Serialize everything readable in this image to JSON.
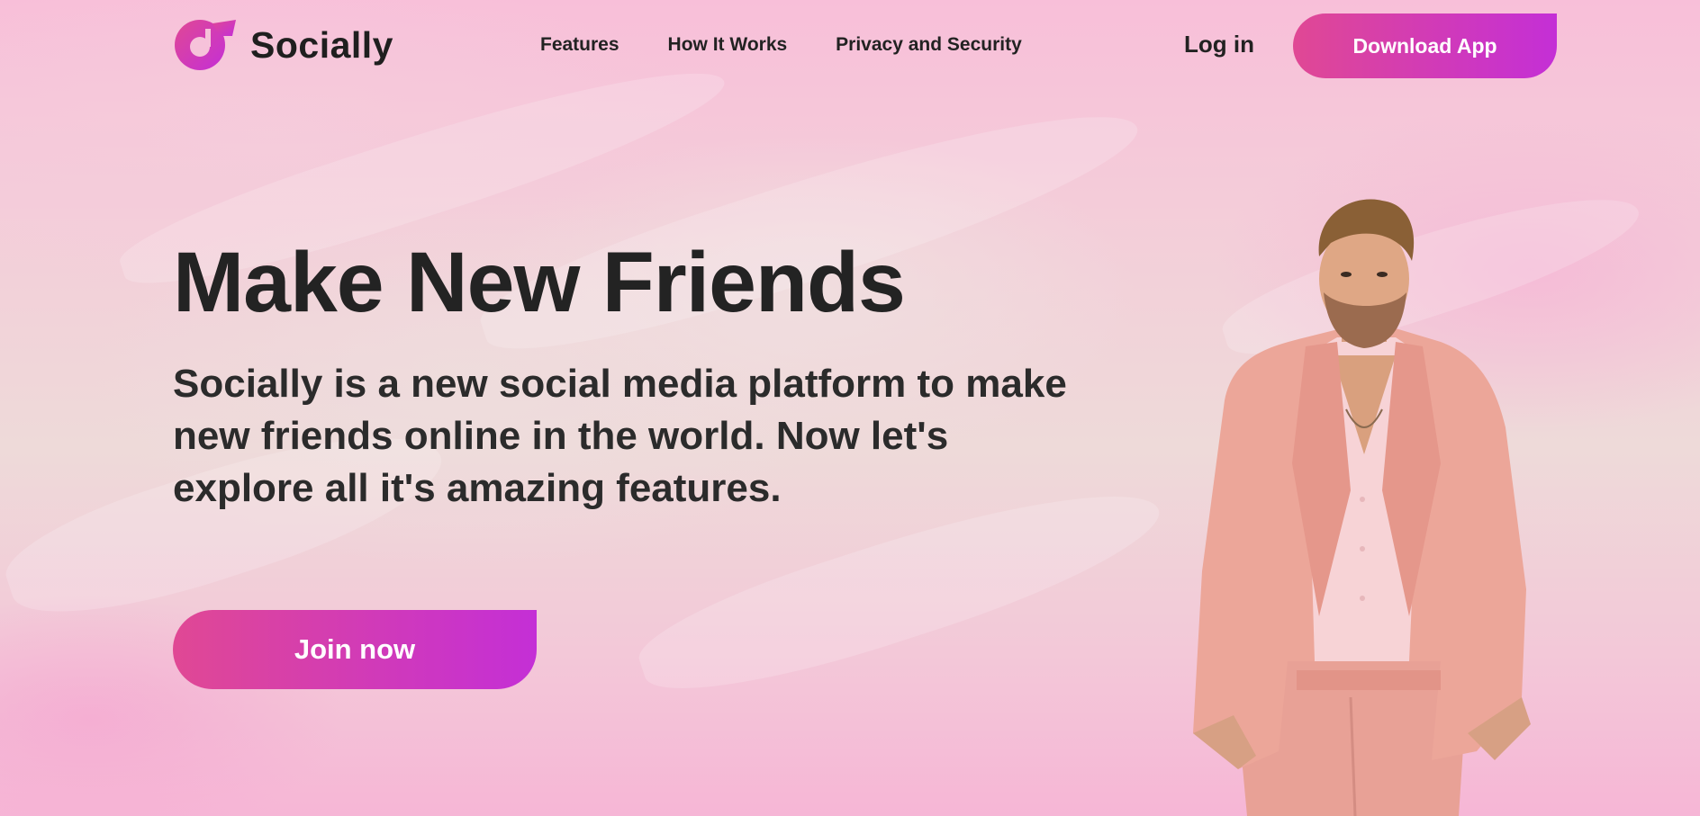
{
  "header": {
    "brand_name": "Socially",
    "nav": [
      {
        "label": "Features"
      },
      {
        "label": "How It Works"
      },
      {
        "label": "Privacy and Security"
      }
    ],
    "login_label": "Log in",
    "download_label": "Download App"
  },
  "hero": {
    "title": "Make New Friends",
    "subtitle": "Socially is a new social media platform to make new friends online in the world. Now let's explore all it's amazing features.",
    "cta_label": "Join now",
    "image": "man-in-pink-suit"
  },
  "colors": {
    "accent_start": "#e04894",
    "accent_end": "#c42fd6",
    "text_dark": "#222222",
    "background_pink": "#f6bfd9"
  },
  "icons": {
    "logo": "music-note-bubble-icon"
  }
}
